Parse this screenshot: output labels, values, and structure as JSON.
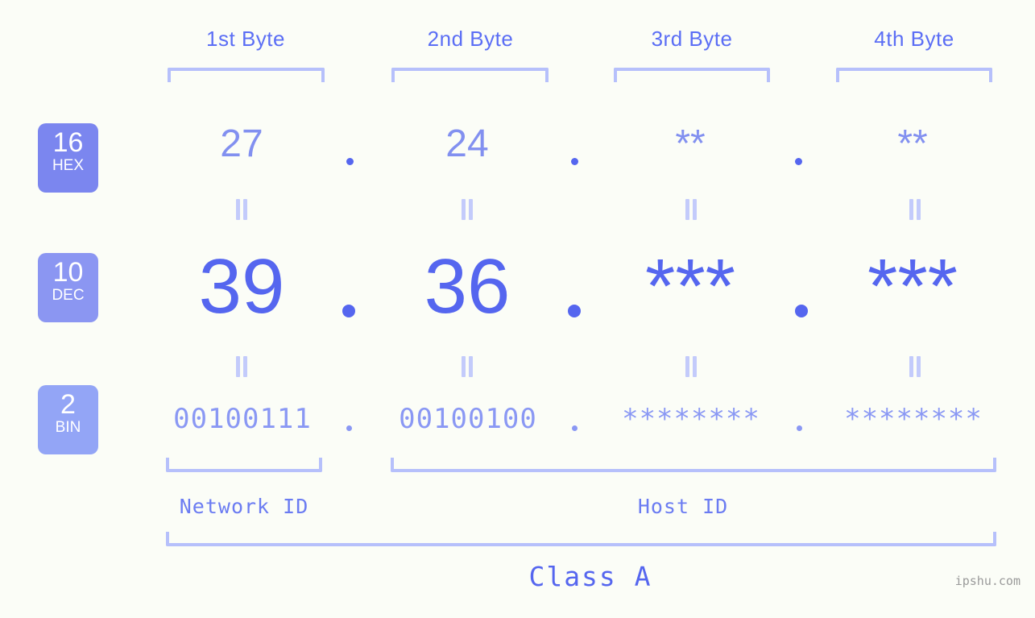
{
  "background_color": "#fbfdf7",
  "accent_color": "#5566ef",
  "accent_light_color": "#b6c0fb",
  "byte_headers": [
    {
      "label": "1st Byte"
    },
    {
      "label": "2nd Byte"
    },
    {
      "label": "3rd Byte"
    },
    {
      "label": "4th Byte"
    }
  ],
  "bases": [
    {
      "number": "16",
      "name": "HEX",
      "color": "#7b86ef"
    },
    {
      "number": "10",
      "name": "DEC",
      "color": "#8b96f2"
    },
    {
      "number": "2",
      "name": "BIN",
      "color": "#93a5f6"
    }
  ],
  "rows": {
    "hex": {
      "values": [
        "27",
        "24",
        "**",
        "**"
      ]
    },
    "dec": {
      "values": [
        "39",
        "36",
        "***",
        "***"
      ]
    },
    "bin": {
      "values": [
        "00100111",
        "00100100",
        "********",
        "********"
      ]
    }
  },
  "separator": ".",
  "equals_symbol": "=",
  "segments": [
    {
      "label": "Network ID"
    },
    {
      "label": "Host ID"
    }
  ],
  "class": {
    "label": "Class A"
  },
  "watermark": {
    "text": "ipshu.com"
  }
}
